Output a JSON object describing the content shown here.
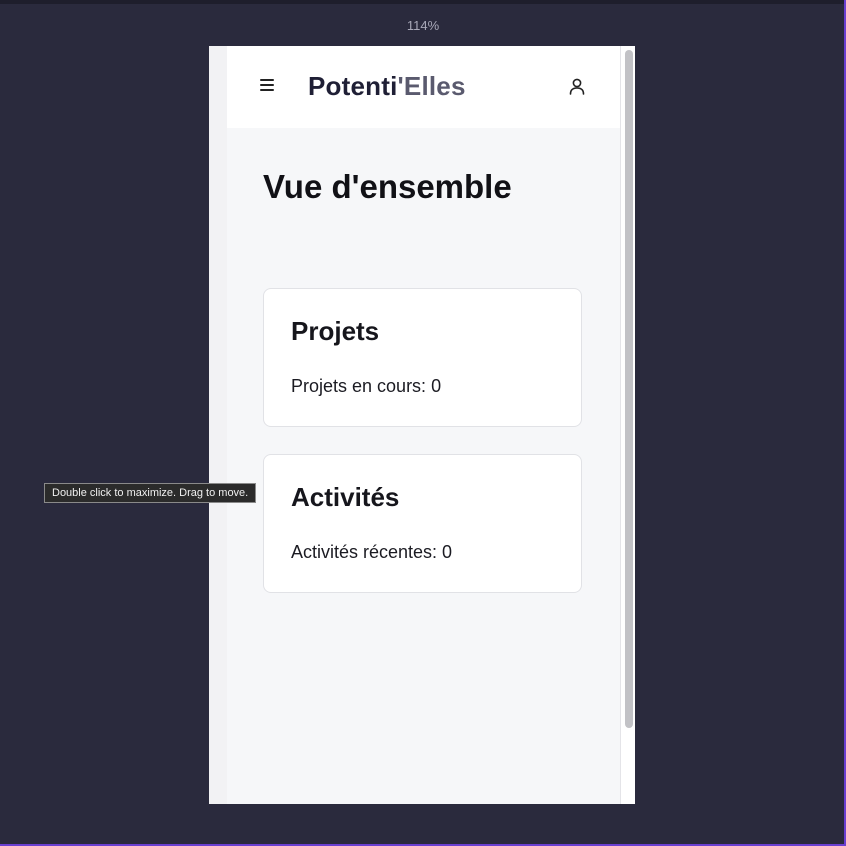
{
  "viewer": {
    "zoom_label": "114%",
    "tooltip": "Double click to maximize. Drag to move."
  },
  "header": {
    "brand_main": "Potenti",
    "brand_accent": "'Elles",
    "menu_icon": "hamburger-menu-icon",
    "user_icon": "user-profile-icon"
  },
  "main": {
    "title": "Vue d'ensemble",
    "cards": [
      {
        "title": "Projets",
        "text": "Projets en cours: 0"
      },
      {
        "title": "Activités",
        "text": "Activités récentes: 0"
      }
    ]
  },
  "colors": {
    "desktop_bg": "#2a2a3d",
    "brand_dark": "#1f1f35",
    "brand_accent": "#5a5a6e",
    "content_bg": "#f6f7f9",
    "window_edge": "#6a3fd0"
  }
}
